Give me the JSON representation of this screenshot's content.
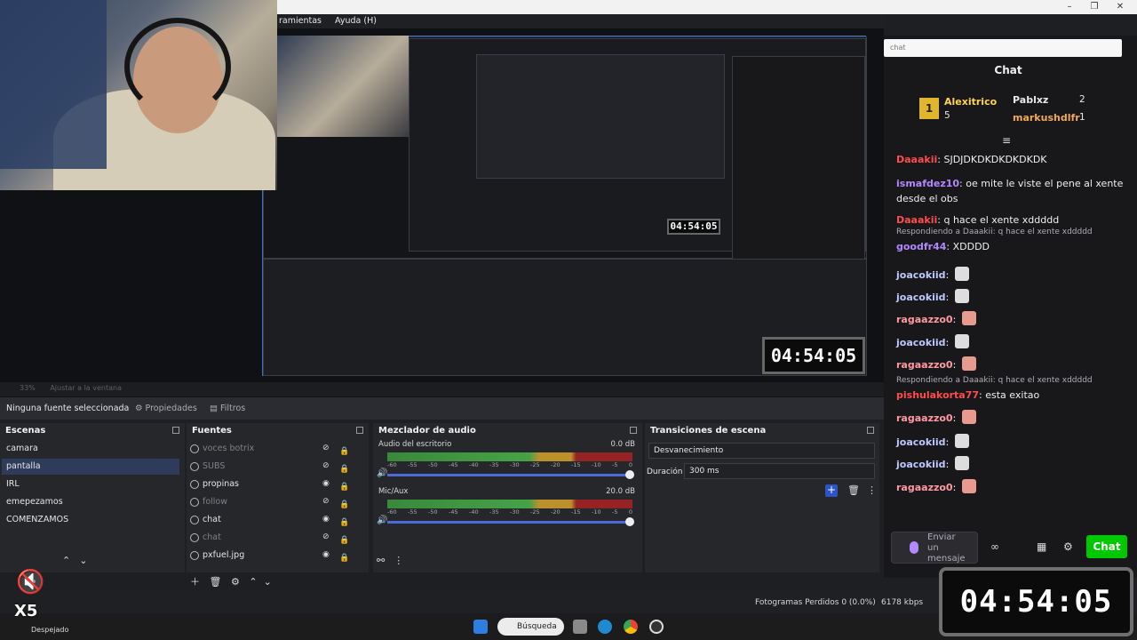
{
  "menubar": {
    "items": [
      "ramientas",
      "Ayuda (H)"
    ]
  },
  "preview": {
    "zoom_text": "33%",
    "fit_text": "Ajustar a la ventana"
  },
  "properties_bar": {
    "selection": "Ninguna fuente seleccionada",
    "properties": "Propiedades",
    "filters": "Filtros"
  },
  "scenes": {
    "title": "Escenas",
    "items": [
      "camara",
      "pantalla",
      "IRL",
      "emepezamos",
      "COMENZAMOS"
    ],
    "selected": "pantalla"
  },
  "sources": {
    "title": "Fuentes",
    "items": [
      {
        "name": "voces botrix",
        "visible": false
      },
      {
        "name": "SUBS",
        "visible": false
      },
      {
        "name": "propinas",
        "visible": true
      },
      {
        "name": "follow",
        "visible": false
      },
      {
        "name": "chat",
        "visible": true
      },
      {
        "name": "chat",
        "visible": false
      },
      {
        "name": "pxfuel.jpg",
        "visible": true
      }
    ]
  },
  "mixer": {
    "title": "Mezclador de audio",
    "channels": [
      {
        "name": "Audio del escritorio",
        "db": "0.0 dB"
      },
      {
        "name": "Mic/Aux",
        "db": "20.0 dB"
      }
    ],
    "ticks": [
      "-60",
      "-55",
      "-50",
      "-45",
      "-40",
      "-35",
      "-30",
      "-25",
      "-20",
      "-15",
      "-10",
      "-5",
      "0"
    ]
  },
  "transitions": {
    "title": "Transiciones de escena",
    "selected": "Desvanecimiento",
    "duration_label": "Duración",
    "duration_value": "300 ms"
  },
  "status": {
    "dropped_frames": "Fotogramas Perdidos 0 (0.0%)",
    "bitrate": "6178 kbps"
  },
  "taskbar": {
    "search_label": "Búsqueda",
    "weather": "Despejado"
  },
  "chat": {
    "search_placeholder": "chat",
    "title": "Chat",
    "leaderboard": [
      {
        "rank": "1",
        "name": "Alexitrico",
        "count": "5"
      },
      {
        "rank": "2",
        "name": "Pablxz",
        "count": "2"
      },
      {
        "rank": "3",
        "name": "markushdlfr",
        "count": "1"
      }
    ],
    "messages": [
      {
        "user": "Daaakii",
        "text": "SJDJDKDKDKDKDKDK",
        "color": "#ff4d4d"
      },
      {
        "user": "ismafdez10",
        "text": "oe mite le viste el pene al xente desde el obs",
        "color": "#b388ff"
      },
      {
        "user": "Daaakii",
        "text": "q hace el xente xddddd",
        "color": "#ff4d4d"
      },
      {
        "reply": "Respondiendo a Daaakii: q hace el xente xddddd",
        "user": "goodfr44",
        "text": "XDDDD",
        "color": "#b388ff"
      },
      {
        "user": "joacokiid",
        "text": "",
        "color": "#bfc9ff"
      },
      {
        "user": "joacokiid",
        "text": "",
        "color": "#bfc9ff"
      },
      {
        "user": "ragaazzo0",
        "text": "",
        "color": "#ff9aa2"
      },
      {
        "user": "joacokiid",
        "text": "",
        "color": "#bfc9ff"
      },
      {
        "user": "ragaazzo0",
        "text": "",
        "color": "#ff9aa2"
      },
      {
        "reply": "Respondiendo a Daaakii: q hace el xente xddddd",
        "user": "pishulakorta77",
        "text": "esta exitao",
        "color": "#ff4d4d"
      },
      {
        "user": "ragaazzo0",
        "text": "",
        "color": "#ff9aa2"
      },
      {
        "user": "joacokiid",
        "text": "",
        "color": "#bfc9ff"
      },
      {
        "user": "joacokiid",
        "text": "",
        "color": "#bfc9ff"
      },
      {
        "user": "ragaazzo0",
        "text": "",
        "color": "#ff9aa2"
      }
    ],
    "input_placeholder": "Enviar un mensaje",
    "send_button": "Chat"
  },
  "timer": {
    "value": "04:54:05"
  },
  "overlay": {
    "multiplier": "X5"
  },
  "colors": {
    "accent": "#3b6ecf",
    "chat_green": "#00c800",
    "twitch_bg": "#18181b"
  }
}
